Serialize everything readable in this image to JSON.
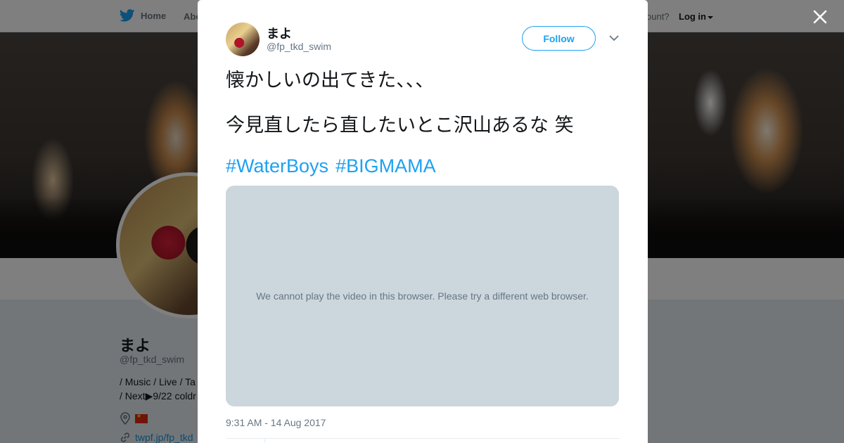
{
  "background_page": {
    "nav": {
      "home_label": "Home",
      "about_label": "Abo",
      "account_prompt": "ccount?",
      "login_label": "Log in"
    },
    "profile": {
      "name": "まよ",
      "handle": "@fp_tkd_swim",
      "bio_line1": "/ Music / Live / Ta",
      "bio_line2": "/ Next▶9/22 coldr",
      "link_text": "twpf.jp/fp_tkd"
    }
  },
  "tweet": {
    "author_name": "まよ",
    "author_handle": "@fp_tkd_swim",
    "follow_label": "Follow",
    "text_line1": "懐かしいの出てきた、、、",
    "text_line2": "今見直したら直したいとこ沢山あるな 笑",
    "hashtags": [
      "#WaterBoys",
      "#BIGMAMA"
    ],
    "video_message": "We cannot play the video in this browser. Please try a different web browser.",
    "timestamp": "9:31 AM - 14 Aug 2017"
  },
  "colors": {
    "accent": "#1da1f2",
    "text_primary": "#14171a",
    "text_secondary": "#657786",
    "video_placeholder": "#ccd6dd",
    "overlay": "rgba(0,0,0,0.5)"
  },
  "icons": {
    "nav_home": "twitter-bird-icon",
    "close": "close-icon",
    "more": "chevron-down-icon",
    "location": "location-pin-icon",
    "link": "link-icon",
    "flag": "china-flag-icon"
  }
}
